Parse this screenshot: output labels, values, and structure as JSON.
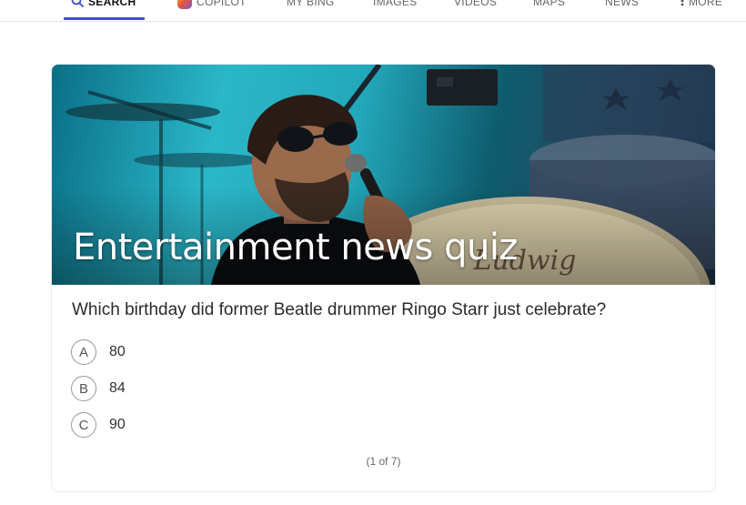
{
  "nav": {
    "items": [
      {
        "label": "SEARCH",
        "icon": "search-icon",
        "active": true
      },
      {
        "label": "COPILOT",
        "icon": "copilot-icon"
      },
      {
        "label": "MY BING"
      },
      {
        "label": "IMAGES"
      },
      {
        "label": "VIDEOS"
      },
      {
        "label": "MAPS"
      },
      {
        "label": "NEWS"
      },
      {
        "label": "MORE",
        "icon": "more-vertical-icon"
      }
    ],
    "accent": "#3d50c8"
  },
  "quiz": {
    "title": "Entertainment news quiz",
    "question": "Which birthday did former Beatle drummer Ringo Starr just celebrate?",
    "options": [
      {
        "letter": "A",
        "text": "80"
      },
      {
        "letter": "B",
        "text": "84"
      },
      {
        "letter": "C",
        "text": "90"
      }
    ],
    "progress": "(1 of 7)"
  }
}
